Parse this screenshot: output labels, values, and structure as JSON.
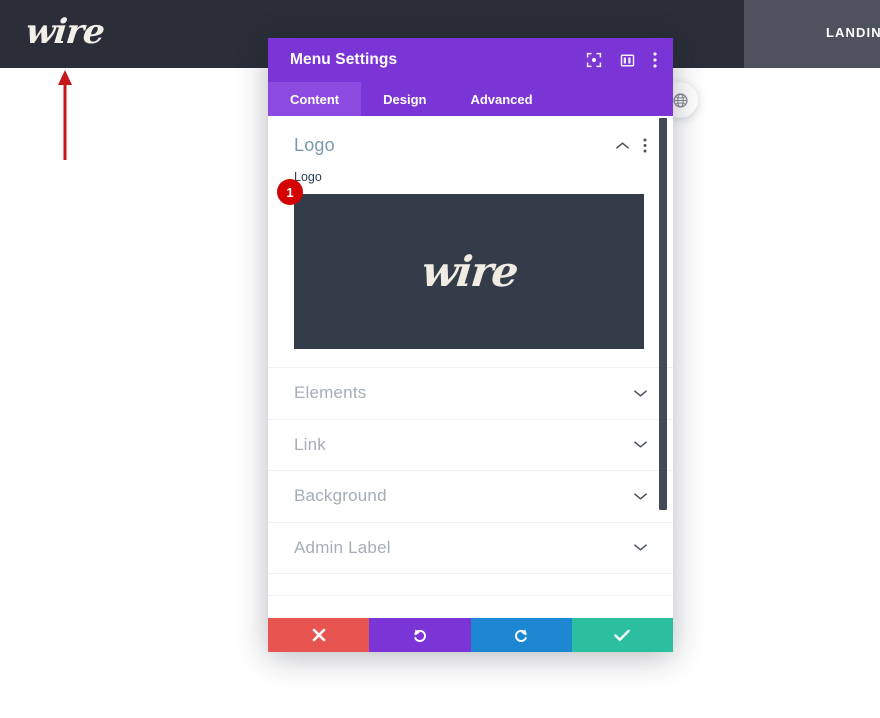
{
  "site": {
    "logo_text": "wire",
    "nav_label": "LANDIN",
    "header_bg": "#2b2e39",
    "header_right_bg": "#4e515e"
  },
  "annotation": {
    "arrow_color": "#c8161d",
    "arrow_direction": "up"
  },
  "float_button": {
    "icon": "globe-icon"
  },
  "modal": {
    "title": "Menu Settings",
    "accent_color": "#7b35d6",
    "title_icons": [
      {
        "name": "focus-icon",
        "label": "Focus"
      },
      {
        "name": "layout-panel-icon",
        "label": "Layout"
      },
      {
        "name": "more-vertical-icon",
        "label": "More options"
      }
    ],
    "tabs": [
      {
        "label": "Content",
        "active": true
      },
      {
        "label": "Design",
        "active": false
      },
      {
        "label": "Advanced",
        "active": false
      }
    ],
    "open_section": {
      "title": "Logo",
      "title_color": "#7a99ad",
      "collapse_icon": "chevron-up-icon",
      "more_icon": "more-vertical-icon",
      "field_label": "Logo",
      "preview": {
        "image_text": "wire",
        "bg_color": "#353c49",
        "badge": "1",
        "badge_color": "#d40000"
      }
    },
    "sections": [
      {
        "title": "Elements",
        "icon": "chevron-down-icon"
      },
      {
        "title": "Link",
        "icon": "chevron-down-icon"
      },
      {
        "title": "Background",
        "icon": "chevron-down-icon"
      },
      {
        "title": "Admin Label",
        "icon": "chevron-down-icon"
      }
    ],
    "scrollbar": {
      "name": "modal-scrollbar"
    },
    "footer_buttons": [
      {
        "name": "cancel-button",
        "icon": "close-icon",
        "color": "#e8544f"
      },
      {
        "name": "undo-button",
        "icon": "undo-icon",
        "color": "#7b35d6"
      },
      {
        "name": "redo-button",
        "icon": "redo-icon",
        "color": "#1e87d1"
      },
      {
        "name": "save-button",
        "icon": "check-icon",
        "color": "#2bbfa0"
      }
    ]
  }
}
